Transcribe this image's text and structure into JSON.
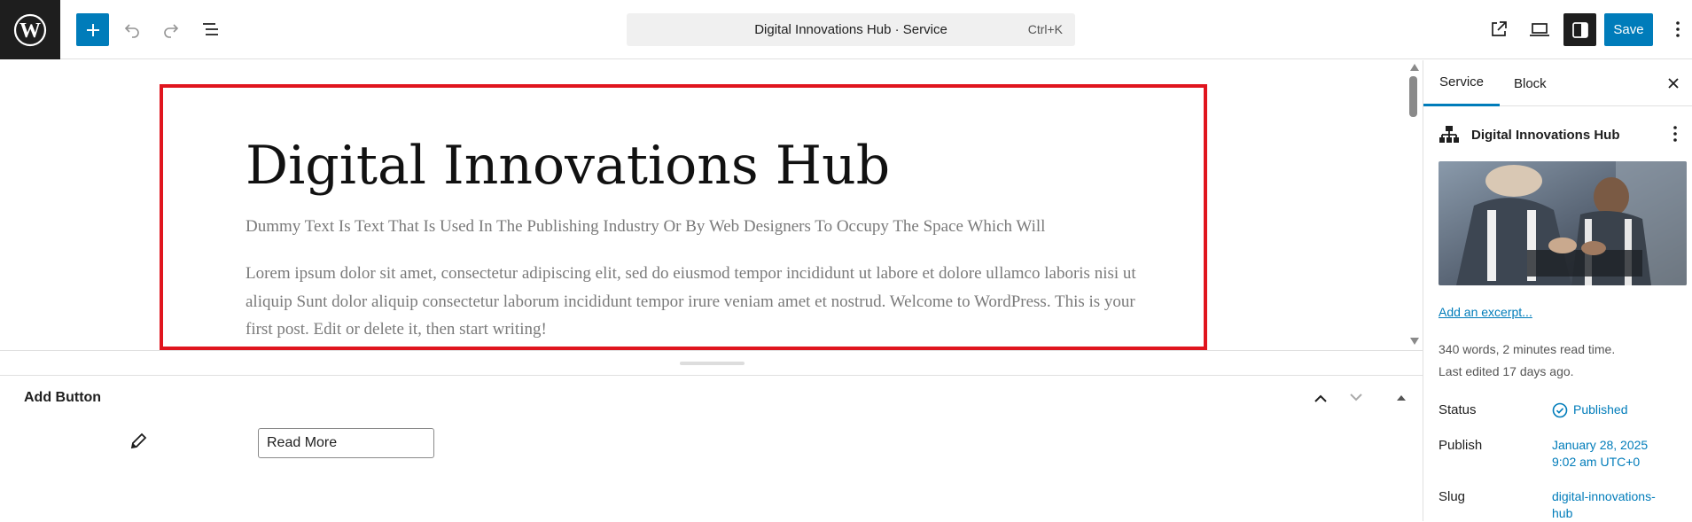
{
  "topbar": {
    "command_title": "Digital Innovations Hub · Service",
    "command_shortcut": "Ctrl+K",
    "save_label": "Save"
  },
  "icons": {
    "logo": "wordpress-logo",
    "add": "plus-icon",
    "undo": "undo-icon",
    "redo": "redo-icon",
    "outline": "list-view-icon",
    "view": "external-link-icon",
    "preview": "laptop-icon",
    "settings": "sidebar-toggle-icon",
    "options": "kebab-menu-icon"
  },
  "hero": {
    "title": "Digital Innovations Hub",
    "subtitle": "Dummy Text Is Text That Is Used In The Publishing Industry Or By Web Designers To Occupy The Space Which Will",
    "body": "Lorem ipsum dolor sit amet, consectetur adipiscing elit, sed do eiusmod tempor incididunt ut labore et dolore ullamco laboris nisi ut aliquip Sunt dolor aliquip consectetur laborum incididunt tempor irure veniam amet et nostrud. Welcome to WordPress. This is your first post. Edit or delete it, then start writing!"
  },
  "meta_box": {
    "title": "Add Button",
    "button_text_value": "Read More"
  },
  "sidebar": {
    "tabs": [
      "Service",
      "Block"
    ],
    "post_title": "Digital Innovations Hub",
    "excerpt_link": "Add an excerpt...",
    "word_count": "340 words, 2 minutes read time.",
    "last_edited": "Last edited 17 days ago.",
    "status_label": "Status",
    "status_value": "Published",
    "publish_label": "Publish",
    "publish_date": "January 28, 2025",
    "publish_time": "9:02 am UTC+0",
    "slug_label": "Slug",
    "slug_line1": "digital-innovations-",
    "slug_line2": "hub"
  },
  "colors": {
    "accent": "#007cba",
    "highlight_border": "#e0151e",
    "dark": "#1e1e1e"
  }
}
